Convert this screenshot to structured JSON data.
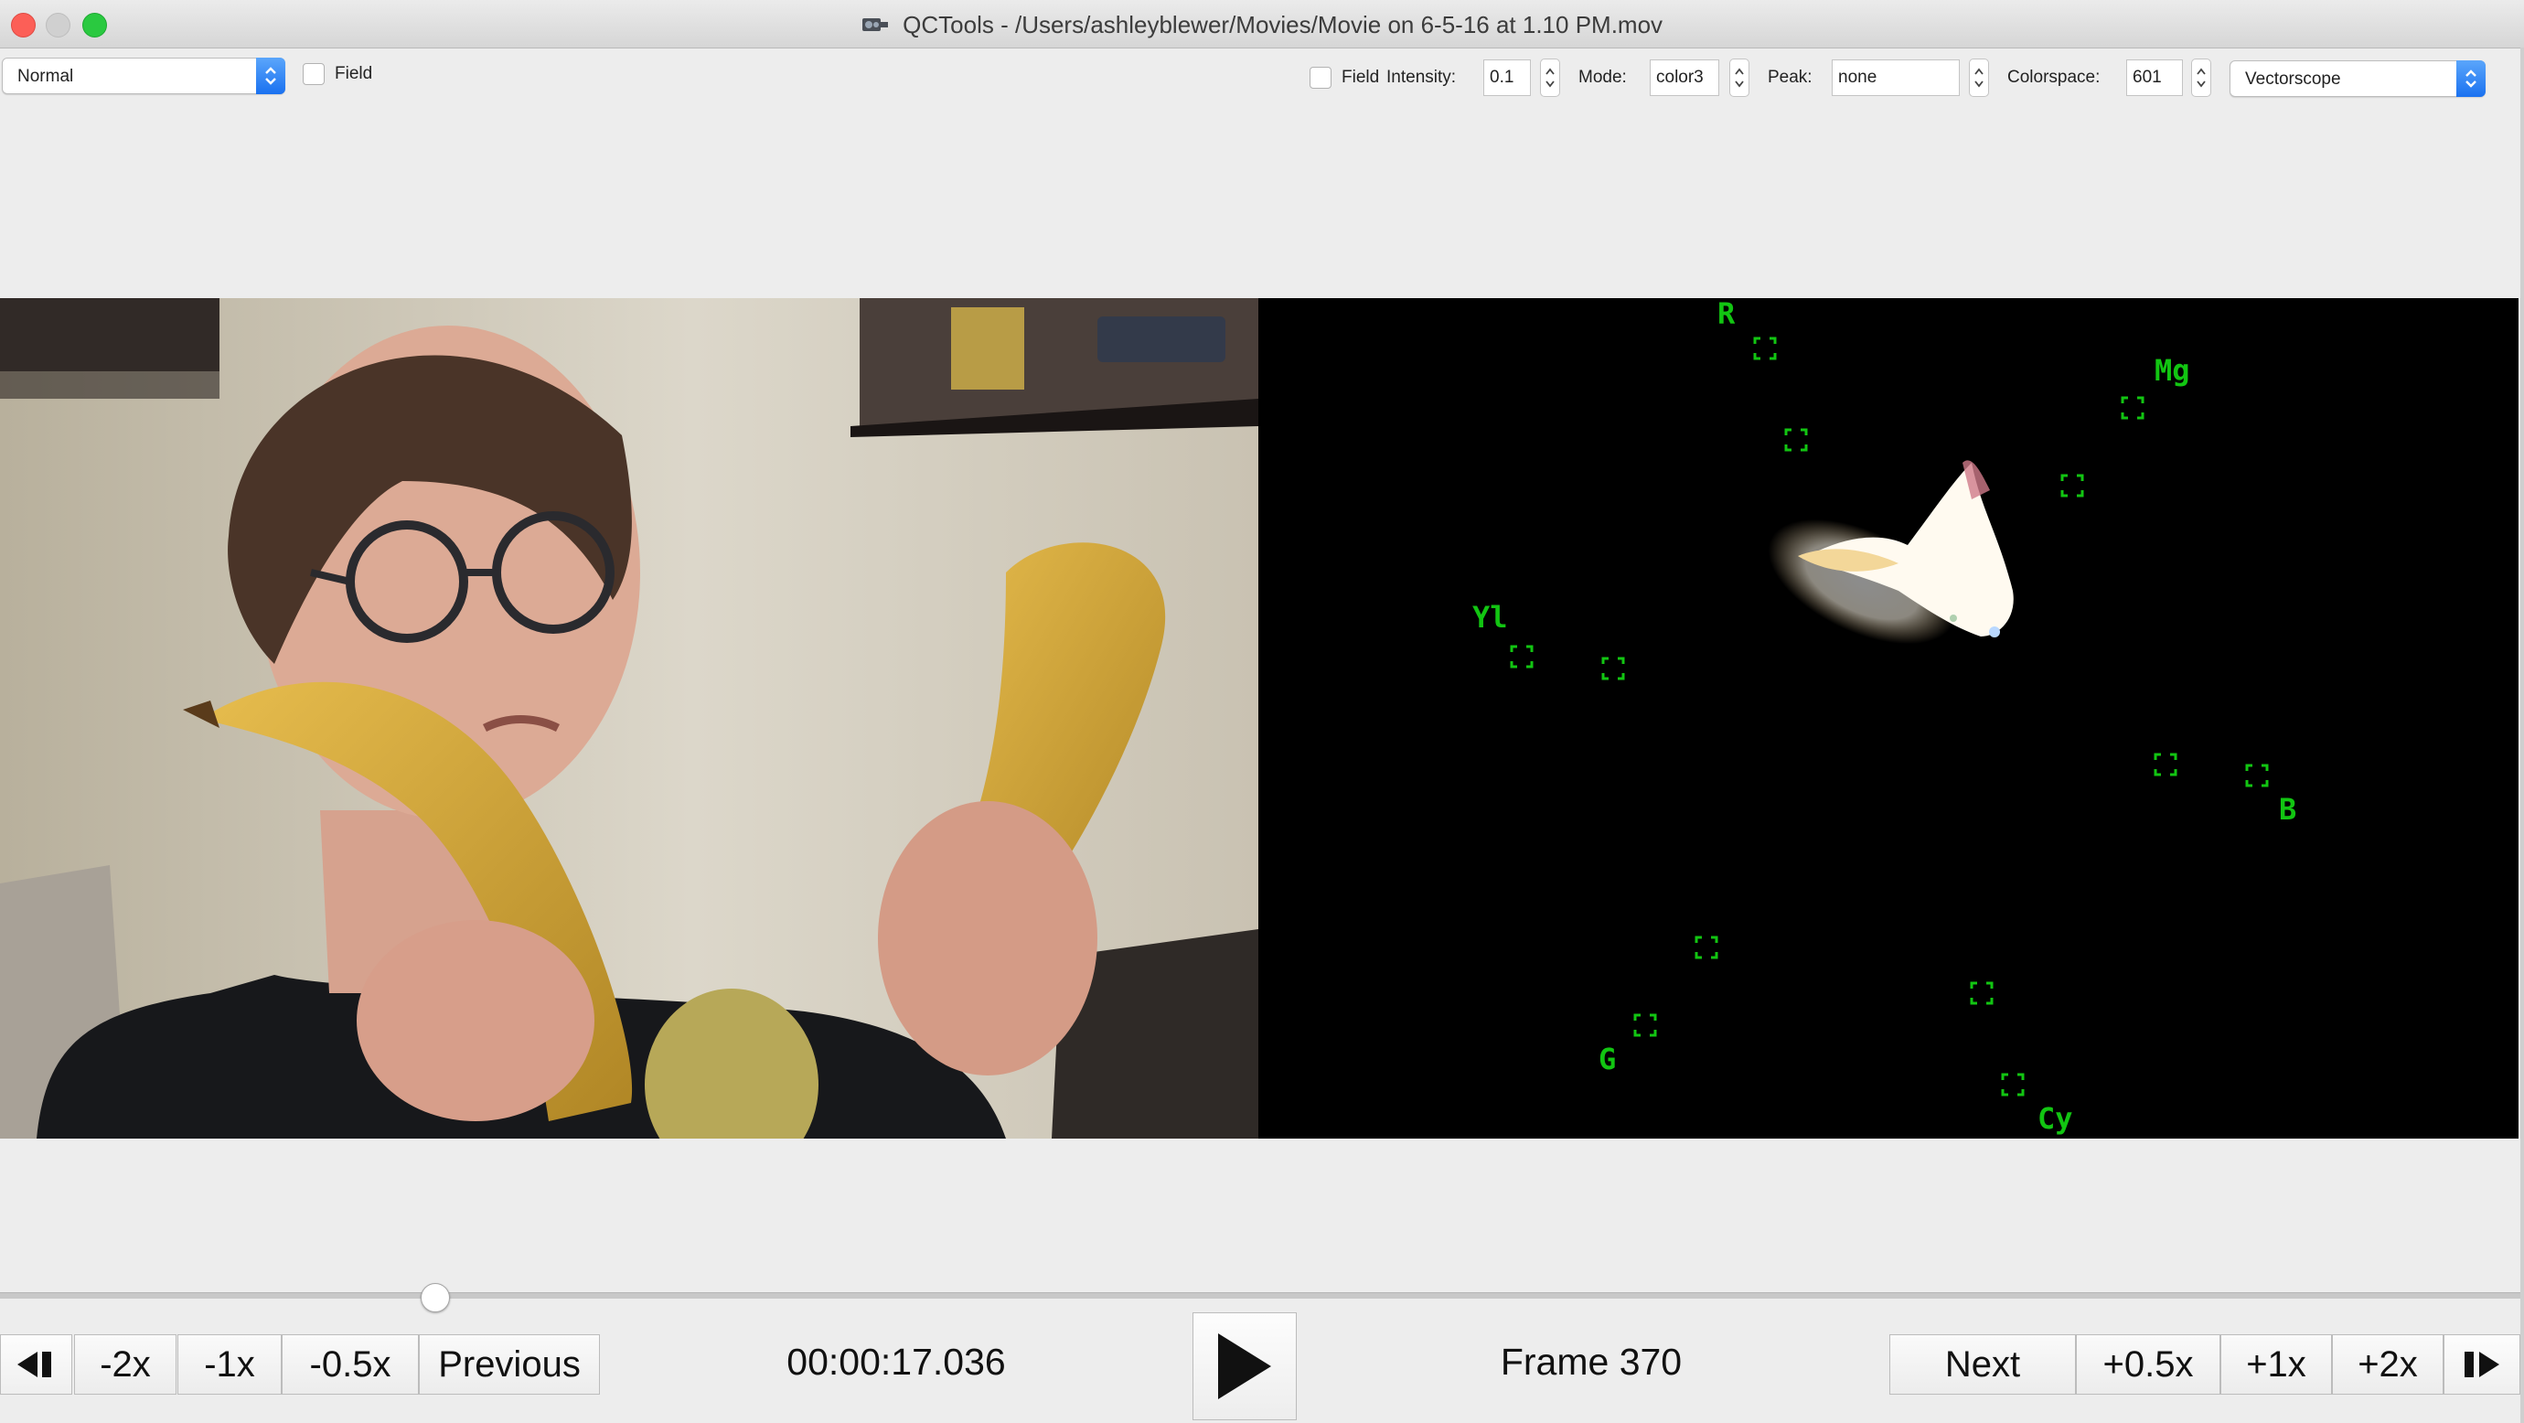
{
  "window": {
    "title": "QCTools - /Users/ashleyblewer/Movies/Movie on 6-5-16 at 1.10 PM.mov"
  },
  "toolbar_left": {
    "view_mode": "Normal",
    "field_label": "Field",
    "field_checked": false
  },
  "toolbar_right": {
    "field_label": "Field",
    "field_checked": false,
    "intensity_label": "Intensity:",
    "intensity_value": "0.1",
    "mode_label": "Mode:",
    "mode_value": "color3",
    "peak_label": "Peak:",
    "peak_value": "none",
    "colorspace_label": "Colorspace:",
    "colorspace_value": "601",
    "filter": "Vectorscope"
  },
  "vectorscope": {
    "labels": {
      "r": "R",
      "mg": "Mg",
      "yl": "Yl",
      "b": "B",
      "g": "G",
      "cy": "Cy"
    },
    "graticule_color": "#12c512"
  },
  "playback": {
    "position_fraction": 0.167,
    "timecode": "00:00:17.036",
    "frame_label": "Frame 370"
  },
  "transport": {
    "minus2": "-2x",
    "minus1": "-1x",
    "minus05": "-0.5x",
    "previous": "Previous",
    "next": "Next",
    "plus05": "+0.5x",
    "plus1": "+1x",
    "plus2": "+2x"
  },
  "icons": {
    "go_start": "skip-to-start-icon",
    "play": "play-icon",
    "go_end": "skip-to-end-icon"
  }
}
